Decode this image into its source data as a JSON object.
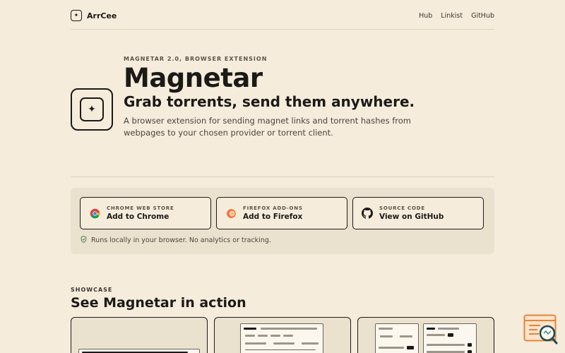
{
  "header": {
    "brand": "ArrCee",
    "nav": [
      "Hub",
      "Linkist",
      "GitHub"
    ]
  },
  "hero": {
    "eyebrow": "MAGNETAR 2.0, BROWSER EXTENSION",
    "title": "Magnetar",
    "tagline": "Grab torrents, send them anywhere.",
    "description": "A browser extension for sending magnet links and torrent hashes from webpages to your chosen provider or torrent client."
  },
  "downloads": [
    {
      "eyebrow": "CHROME WEB STORE",
      "label": "Add to Chrome",
      "icon": "chrome-icon"
    },
    {
      "eyebrow": "FIREFOX ADD-ONS",
      "label": "Add to Firefox",
      "icon": "firefox-icon"
    },
    {
      "eyebrow": "SOURCE CODE",
      "label": "View on GitHub",
      "icon": "github-icon"
    }
  ],
  "privacy_note": "Runs locally in your browser. No analytics or tracking.",
  "showcase": {
    "eyebrow": "SHOWCASE",
    "title": "See Magnetar in action"
  },
  "colors": {
    "background": "#f5ecdc",
    "panel": "#ebe1cf",
    "ink": "#1c1a17",
    "accent": "#e8833a"
  }
}
